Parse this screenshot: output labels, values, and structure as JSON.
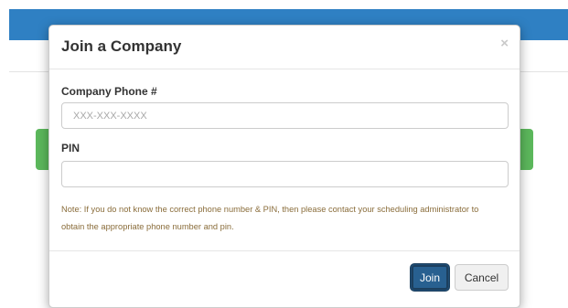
{
  "modal": {
    "title": "Join a Company",
    "close_label": "×",
    "phone_label": "Company Phone #",
    "phone_placeholder": "XXX-XXX-XXXX",
    "phone_value": "",
    "pin_label": "PIN",
    "pin_placeholder": "",
    "pin_value": "",
    "note": "Note: If you do not know the correct phone number & PIN, then please contact your scheduling administrator to obtain the appropriate phone number and pin.",
    "join_label": "Join",
    "cancel_label": "Cancel"
  },
  "colors": {
    "top_bar": "#2f80c3",
    "green_button": "#5cb85c",
    "join_button": "#286090",
    "note_text": "#8a6d3b"
  }
}
